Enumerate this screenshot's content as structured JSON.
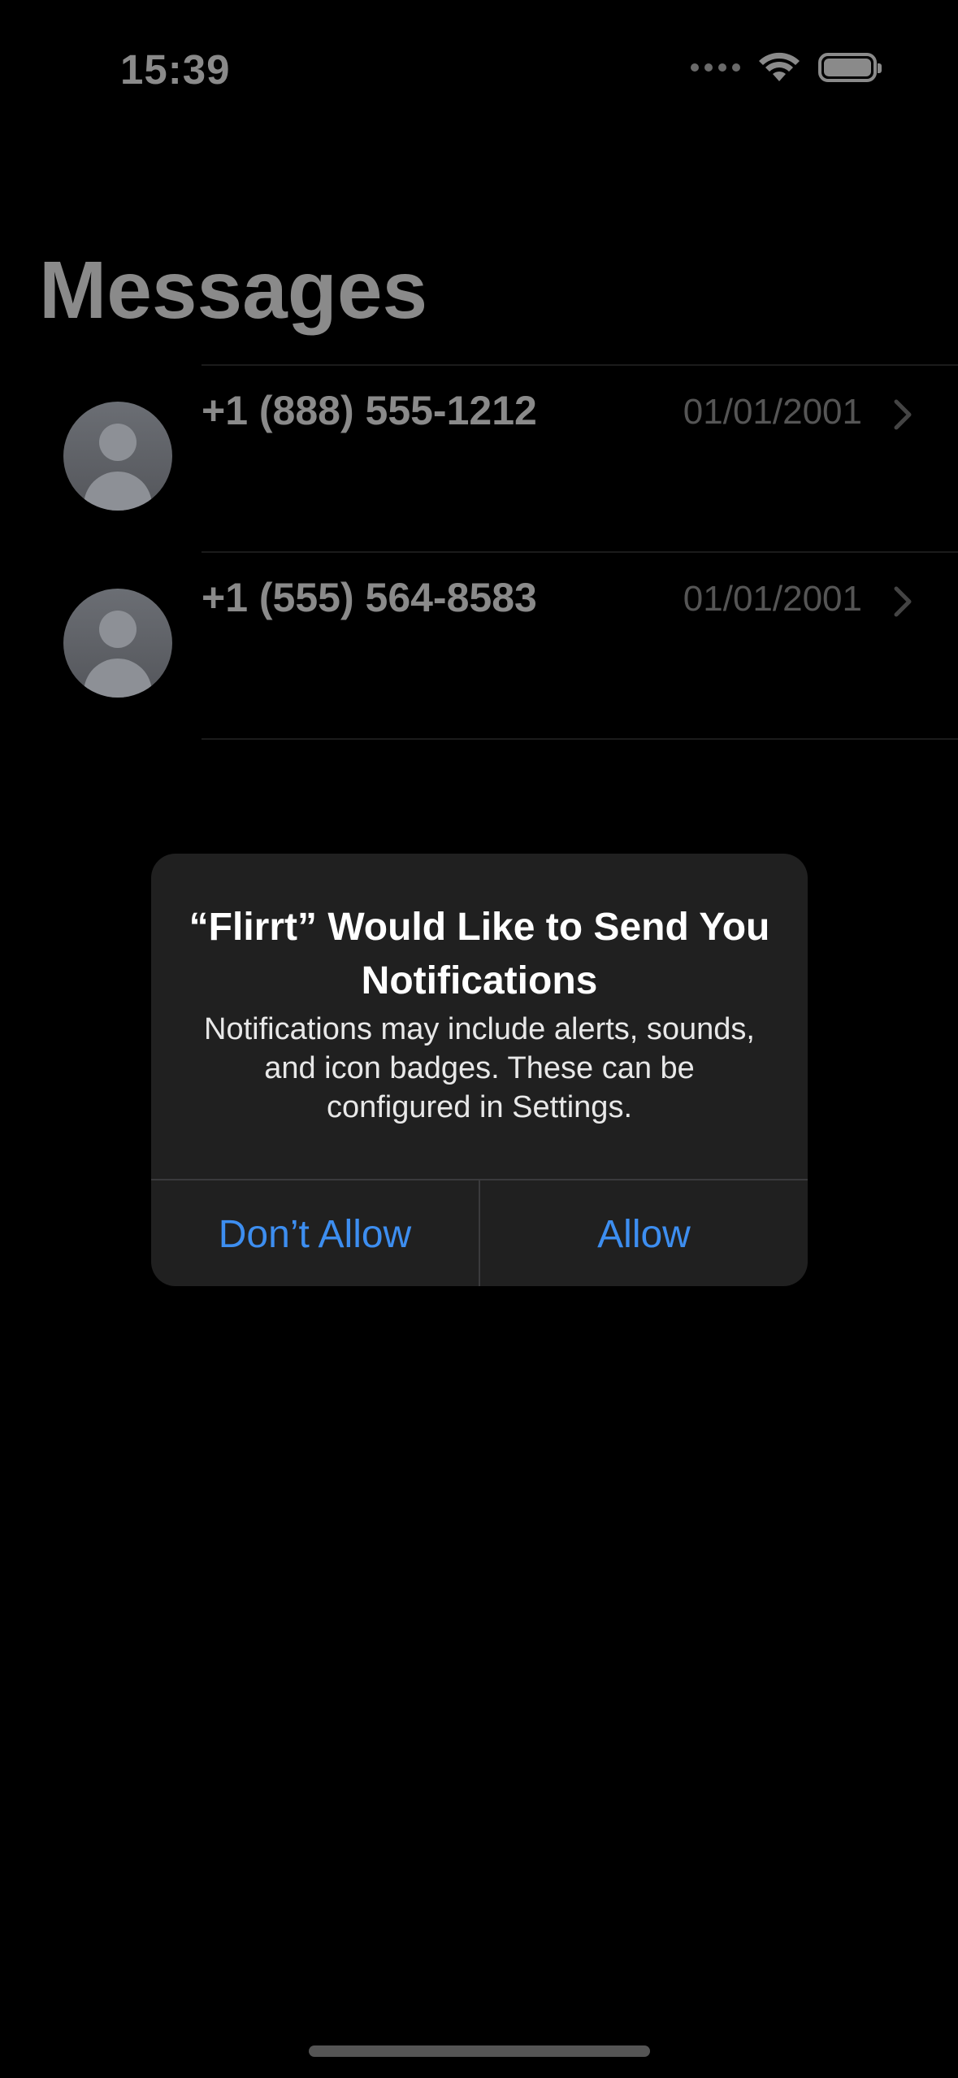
{
  "status_bar": {
    "time": "15:39",
    "icons": [
      "cellular-signal-icon",
      "wifi-icon",
      "battery-icon"
    ],
    "color": "#8a8a8a"
  },
  "page": {
    "title": "Messages"
  },
  "conversations": [
    {
      "name": "+1 (888) 555-1212",
      "date": "01/01/2001",
      "avatar_icon": "person-placeholder-icon"
    },
    {
      "name": "+1 (555) 564-8583",
      "date": "01/01/2001",
      "avatar_icon": "person-placeholder-icon"
    }
  ],
  "alert": {
    "title": "“Flirrt” Would Like to Send You Notifications",
    "message": "Notifications may include alerts, sounds, and icon badges. These can be configured in Settings.",
    "buttons": {
      "deny": "Don’t Allow",
      "allow": "Allow"
    },
    "accent_color": "#3d8ef0",
    "background_color": "#202020"
  }
}
